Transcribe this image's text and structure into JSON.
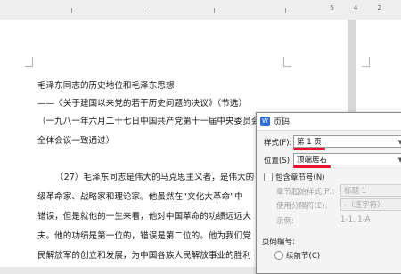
{
  "ruler": {
    "numbers": "6 4 2"
  },
  "document": {
    "lines": [
      "毛泽东同志的历史地位和毛泽东思想",
      "——《关于建国以来党的若干历史问题的决议》（节选）",
      "（一九八一年六月二十七日中国共产党第十一届中央委员会",
      "全体会议一致通过）",
      "（27）毛泽东同志是伟大的马克思主义者，是伟大的",
      "级革命家、战略家和理论家。他虽然在“文化大革命”中",
      "错误，但是就他的一生来看，他对中国革命的功绩远远大",
      "夫。他的功绩是第一位的，错误是第二位的。他为我们党",
      "民解放军的创立和发展，为中国各族人民解放事业的胜利"
    ]
  },
  "dialog": {
    "title": "页码",
    "icon_text": "W",
    "style_label": "样式(F):",
    "style_value": "第 1 页",
    "position_label": "位置(S):",
    "position_value": "顶端居右",
    "include_chapter_label": "包含章节号(N)",
    "chapter_style_label": "章节起始样式(P):",
    "chapter_style_value": "标题 1",
    "separator_label": "使用分隔符(E):",
    "separator_value": "-（连字符）",
    "example_label": "示例:",
    "example_value": "1-1, 1-A",
    "numbering_label": "页码编号:",
    "continue_label": "续前节(C)",
    "accent_color": "#e8132a"
  }
}
